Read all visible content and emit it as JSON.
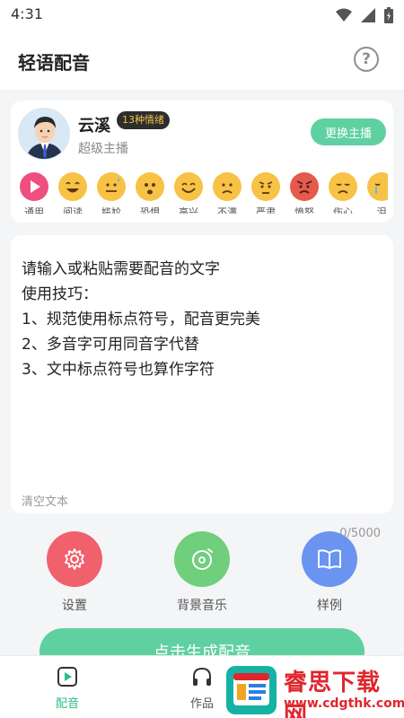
{
  "status_bar": {
    "time": "4:31"
  },
  "header": {
    "title": "轻语配音",
    "help_label": "?"
  },
  "voice": {
    "name": "云溪",
    "emotion_badge": "13种情绪",
    "level": "超级主播",
    "change_button": "更换主播"
  },
  "emotions": [
    {
      "label": "通用",
      "icon": "play-icon"
    },
    {
      "label": "阅读",
      "icon": "laugh-icon"
    },
    {
      "label": "尴尬",
      "icon": "awkward-icon"
    },
    {
      "label": "恐惧",
      "icon": "fear-icon"
    },
    {
      "label": "高兴",
      "icon": "happy-icon"
    },
    {
      "label": "不满",
      "icon": "displeased-icon"
    },
    {
      "label": "严肃",
      "icon": "serious-icon"
    },
    {
      "label": "愤怒",
      "icon": "angry-icon"
    },
    {
      "label": "伤心",
      "icon": "sad-icon"
    },
    {
      "label": "泪",
      "icon": "crying-icon"
    }
  ],
  "editor": {
    "lines": [
      "请输入或粘贴需要配音的文字",
      "使用技巧：",
      "1、规范使用标点符号，配音更完美",
      "2、多音字可用同音字代替",
      "3、文中标点符号也算作字符"
    ],
    "clear_label": "清空文本",
    "count": "0/5000"
  },
  "actions": {
    "settings": "设置",
    "music": "背景音乐",
    "examples": "样例"
  },
  "generate_button": "点击生成配音",
  "tabs": {
    "dubbing": "配音",
    "works": "作品"
  },
  "watermark": {
    "title": "睿思下载网",
    "url": "www.cdgthk.com"
  },
  "colors": {
    "accent": "#5fd0a0",
    "settings": "#f0606d",
    "music": "#6fcf7c",
    "examples": "#6a94f0"
  }
}
